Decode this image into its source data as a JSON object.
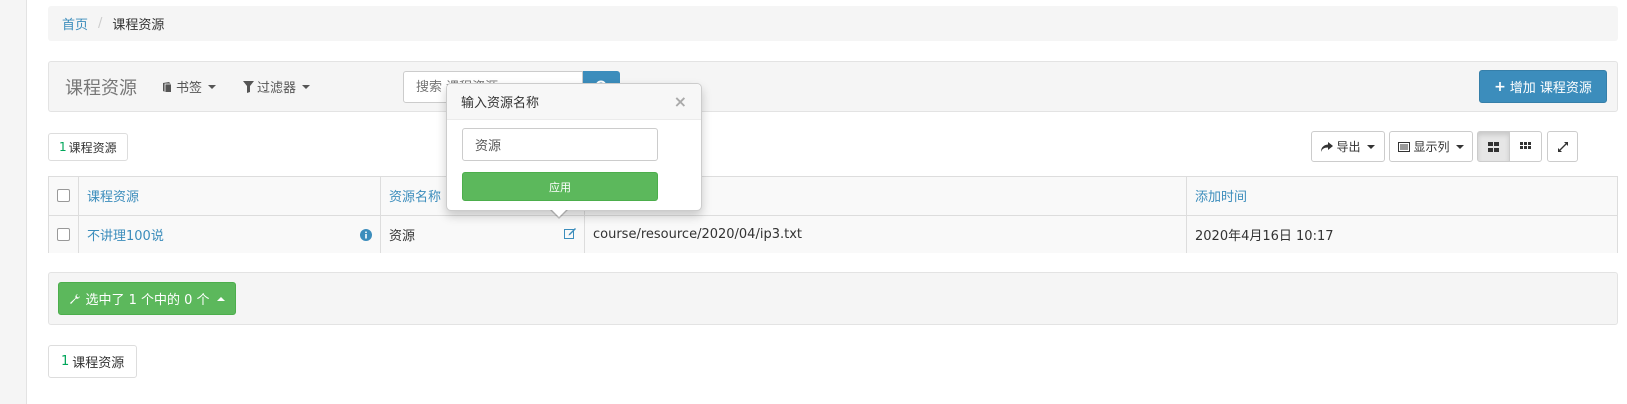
{
  "breadcrumb": {
    "home": "首页",
    "separator": "/",
    "current": "课程资源"
  },
  "header": {
    "title": "课程资源",
    "bookmark_label": "书签",
    "filter_label": "过滤器",
    "search_placeholder": "搜索 课程资源",
    "add_label": "增加 课程资源"
  },
  "summary": {
    "count": "1",
    "label": "课程资源"
  },
  "toolbar": {
    "export_label": "导出",
    "columns_label": "显示列"
  },
  "table": {
    "headers": [
      "课程资源",
      "资源名称",
      "",
      "添加时间"
    ],
    "rows": [
      {
        "course_resource": "不讲理100说",
        "resource_name": "资源",
        "path": "course/resource/2020/04/ip3.txt",
        "added_time": "2020年4月16日 10:17"
      }
    ]
  },
  "footer": {
    "select_label": "选中了 1 个中的 0 个"
  },
  "popover": {
    "title": "输入资源名称",
    "close": "×",
    "input_value": "资源",
    "apply_label": "应用"
  },
  "colors": {
    "primary": "#3c8dbc",
    "success": "#5cb85c",
    "count_green": "#00a65a"
  }
}
